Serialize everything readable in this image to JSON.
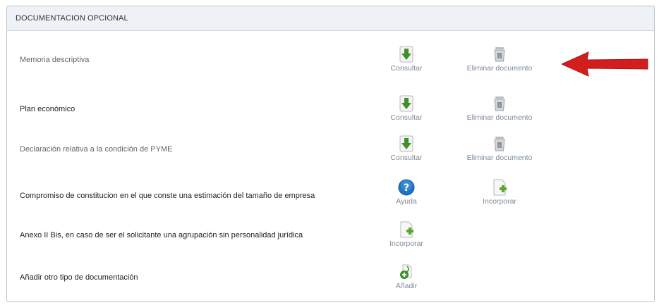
{
  "panel": {
    "title": "DOCUMENTACION OPCIONAL"
  },
  "rows": [
    {
      "label": "Memoria descriptiva",
      "actions": [
        {
          "label": "Consultar",
          "icon": "download-icon"
        },
        {
          "label": "Eliminar documento",
          "icon": "trash-icon"
        }
      ]
    },
    {
      "label": "Plan económico",
      "actions": [
        {
          "label": "Consultar",
          "icon": "download-icon"
        },
        {
          "label": "Eliminar documento",
          "icon": "trash-icon"
        }
      ]
    },
    {
      "label": "Declaración relativa a la condición de PYME",
      "actions": [
        {
          "label": "Consultar",
          "icon": "download-icon"
        },
        {
          "label": "Eliminar documento",
          "icon": "trash-icon"
        }
      ]
    },
    {
      "label": "Compromiso de constitucion en el que conste una estimación del tamaño de empresa",
      "actions": [
        {
          "label": "Ayuda",
          "icon": "help-icon"
        },
        {
          "label": "Incorporar",
          "icon": "add-document-icon"
        }
      ]
    },
    {
      "label": "Anexo II Bis, en caso de ser el solicitante una agrupación sin personalidad jurídica",
      "actions": [
        {
          "label": "Incorporar",
          "icon": "add-document-icon"
        }
      ]
    },
    {
      "label": "Añadir otro tipo de documentación",
      "actions": [
        {
          "label": "Añadir",
          "icon": "add-attachment-icon"
        }
      ]
    }
  ],
  "colors": {
    "arrow": "#d41e1e",
    "icon_green": "#3f8f2a",
    "help_blue": "#1f74c4",
    "caption_gray": "#7c8a98"
  }
}
